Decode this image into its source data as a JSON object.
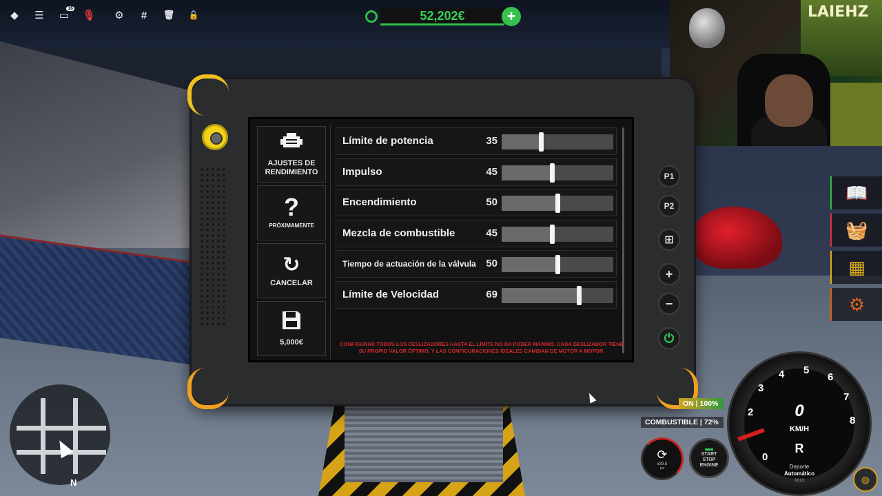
{
  "topbar": {
    "icons": [
      "roblox-logo-icon",
      "menu-icon",
      "chat-icon",
      "microphone-icon",
      "gear-icon",
      "hash-icon",
      "trash-icon",
      "lock-icon"
    ],
    "chat_badge": "16"
  },
  "money": {
    "amount": "52,202€",
    "add_label": "+"
  },
  "tablet": {
    "side_buttons": [
      {
        "label": "AJUSTES DE RENDIMIENTO",
        "icon": "engine-icon"
      },
      {
        "label": "PRÓXIMAMENTE",
        "icon": "question-icon",
        "glyph": "?"
      },
      {
        "label": "CANCELAR",
        "icon": "undo-icon",
        "glyph": "↻"
      },
      {
        "label": "5,000€",
        "icon": "save-icon"
      }
    ],
    "sliders": [
      {
        "name": "Límite de potencia",
        "value": 35,
        "fraction": 0.35
      },
      {
        "name": "Impulso",
        "value": 45,
        "fraction": 0.45
      },
      {
        "name": "Encendimiento",
        "value": 50,
        "fraction": 0.5
      },
      {
        "name": "Mezcla de combustible",
        "value": 45,
        "fraction": 0.45
      },
      {
        "name": "Tiempo de actuación de la válvula",
        "value": 50,
        "fraction": 0.5
      },
      {
        "name": "Límite de Velocidad",
        "value": 69,
        "fraction": 0.69
      }
    ],
    "warning": "CONFIGURAR TODOS LOS DESLIZADORES HASTA EL LÍMITE NO DA PODER MÁXIMO. CADA DESLIZADOR TIENE SU PROPIO VALOR ÓPTIMO, Y LAS CONFIGURACIONES IDEALES CAMBIAN DE MOTOR A MOTOR.",
    "hardware_buttons": [
      "P1",
      "P2",
      "⊞",
      "+",
      "−",
      "⏻"
    ]
  },
  "right_menu": [
    {
      "icon": "book-icon",
      "glyph": "📖",
      "color": "#2fbf4a"
    },
    {
      "icon": "basket-icon",
      "glyph": "🧺",
      "color": "#e03040"
    },
    {
      "icon": "warehouse-icon",
      "glyph": "▦",
      "color": "#e0b020"
    },
    {
      "icon": "gear-crown-icon",
      "glyph": "⚙",
      "color": "#e06020"
    }
  ],
  "dashboard": {
    "health_label": "ON | 100%",
    "fuel_label": "COMBUSTIBLE | 72%",
    "speed": "0",
    "unit": "KM/H",
    "gear": "R",
    "mode_line1": "Deporte",
    "mode_line2": "Automático",
    "odometer": "0013",
    "gauge_numbers": [
      "0",
      "2",
      "3",
      "4",
      "5",
      "6",
      "7",
      "8"
    ],
    "turbo_value": "x39.5",
    "turbo_unit": "psi",
    "start_label": "START STOP ENGINE"
  },
  "minimap": {
    "north": "N"
  },
  "webcam": {
    "poster_text": "LAIEHZ"
  },
  "colors": {
    "accent_green": "#39d35a",
    "warning_red": "#d42a2a",
    "tablet_yellow": "#f0c020"
  }
}
